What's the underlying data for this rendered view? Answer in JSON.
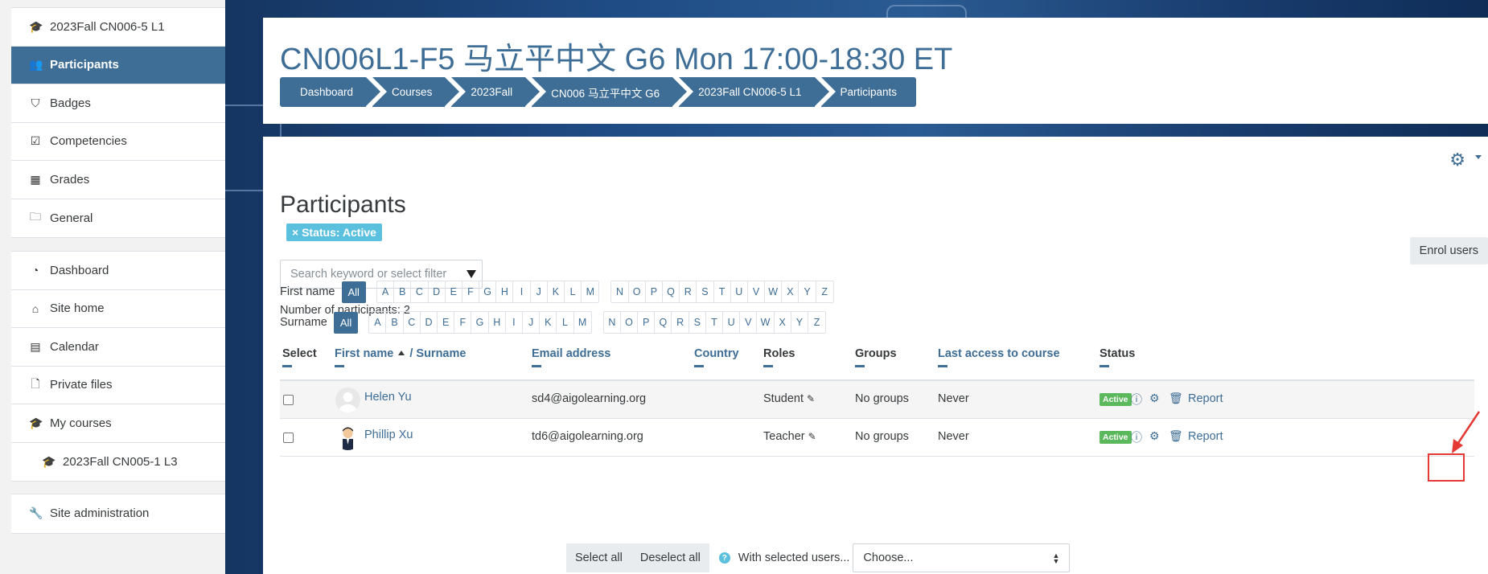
{
  "drawer": {
    "course_nav": [
      {
        "label": "2023Fall CN006-5 L1",
        "icon": "graduation-cap-icon"
      },
      {
        "label": "Participants",
        "icon": "users-icon",
        "active": true
      },
      {
        "label": "Badges",
        "icon": "shield-icon"
      },
      {
        "label": "Competencies",
        "icon": "check-square-icon"
      },
      {
        "label": "Grades",
        "icon": "table-icon"
      },
      {
        "label": "General",
        "icon": "folder-icon"
      }
    ],
    "site_nav": [
      {
        "label": "Dashboard",
        "icon": "tachometer-icon"
      },
      {
        "label": "Site home",
        "icon": "home-icon"
      },
      {
        "label": "Calendar",
        "icon": "calendar-icon"
      },
      {
        "label": "Private files",
        "icon": "file-icon"
      },
      {
        "label": "My courses",
        "icon": "graduation-cap-icon"
      },
      {
        "label": "2023Fall CN005-1 L3",
        "icon": "graduation-cap-icon"
      }
    ],
    "admin_nav": [
      {
        "label": "Site administration",
        "icon": "wrench-icon"
      }
    ]
  },
  "header": {
    "course_title": "CN006L1-F5 马立平中文 G6 Mon 17:00-18:30 ET",
    "breadcrumb": [
      "Dashboard",
      "Courses",
      "2023Fall",
      "CN006 马立平中文 G6",
      "2023Fall CN006-5 L1",
      "Participants"
    ]
  },
  "main": {
    "heading": "Participants",
    "filter_chip": "× Status: Active",
    "enrol_button": "Enrol users",
    "search_placeholder": "Search keyword or select filter",
    "participant_count": "Number of participants: 2",
    "initials": {
      "first_name_label": "First name",
      "surname_label": "Surname",
      "all_label": "All",
      "letters_a_m": [
        "A",
        "B",
        "C",
        "D",
        "E",
        "F",
        "G",
        "H",
        "I",
        "J",
        "K",
        "L",
        "M"
      ],
      "letters_n_z": [
        "N",
        "O",
        "P",
        "Q",
        "R",
        "S",
        "T",
        "U",
        "V",
        "W",
        "X",
        "Y",
        "Z"
      ]
    },
    "table": {
      "headers": {
        "select": "Select",
        "first_name": "First name",
        "surname": "/ Surname",
        "email": "Email address",
        "country": "Country",
        "roles": "Roles",
        "groups": "Groups",
        "last_access": "Last access to course",
        "status": "Status"
      },
      "rows": [
        {
          "name": "Helen Yu",
          "email": "sd4@aigolearning.org",
          "role": "Student",
          "groups": "No groups",
          "last_access": "Never",
          "status": "Active",
          "report": "Report"
        },
        {
          "name": "Phillip Xu",
          "email": "td6@aigolearning.org",
          "role": "Teacher",
          "groups": "No groups",
          "last_access": "Never",
          "status": "Active",
          "report": "Report"
        }
      ]
    },
    "bulk": {
      "select_all": "Select all",
      "deselect_all": "Deselect all",
      "with_selected": "With selected users...",
      "choose": "Choose..."
    }
  },
  "colors": {
    "accent": "#3e6d96",
    "active_badge": "#5cb85c",
    "chip": "#5bc0de",
    "highlight": "#e53935"
  }
}
